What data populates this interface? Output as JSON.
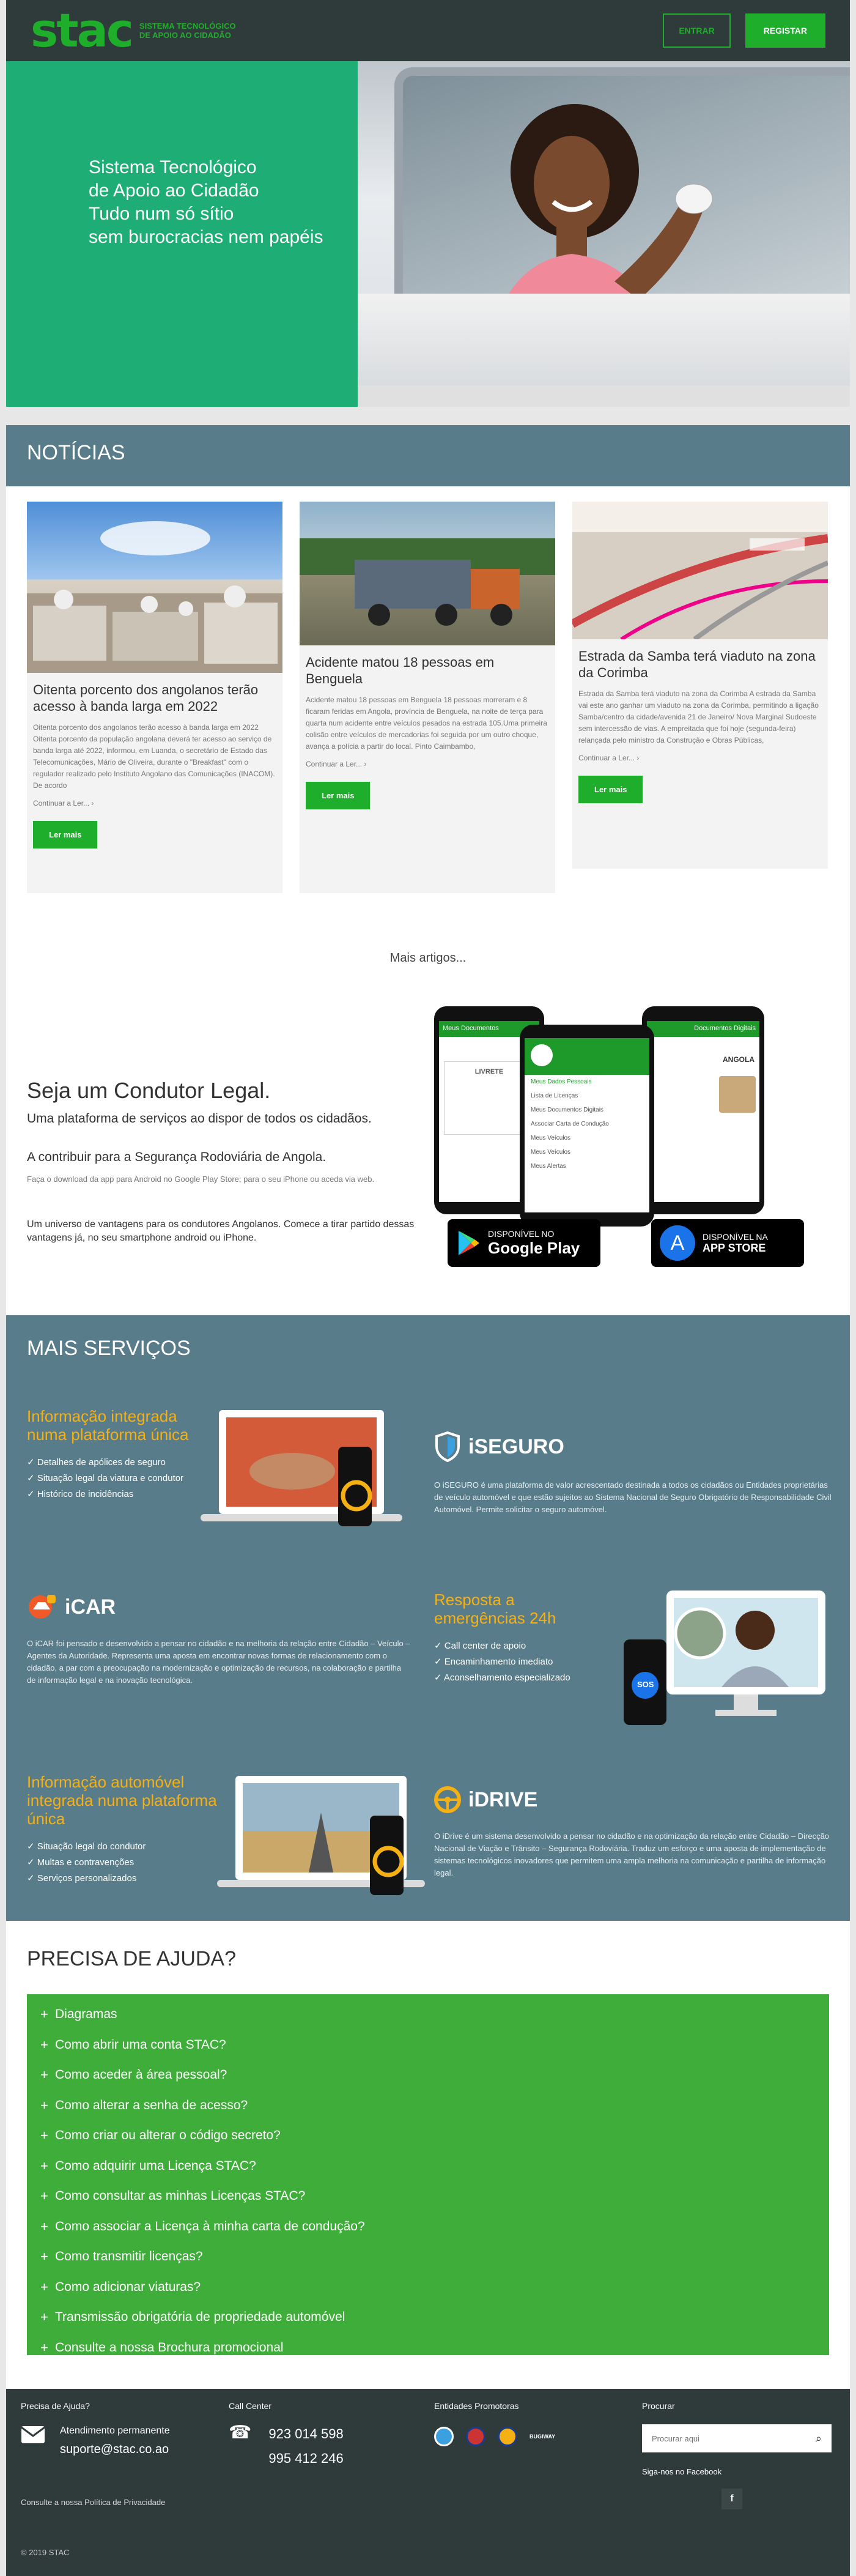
{
  "header": {
    "logo_mark": "stac",
    "logo_sub": "Sistema Tecnológico de Apoio ao Cidadão",
    "login_label": "ENTRAR",
    "register_label": "REGISTAR"
  },
  "hero": {
    "line1": "Sistema Tecnológico",
    "line2": "de Apoio ao Cidadão",
    "line3": "Tudo num só sítio",
    "line4": "sem burocracias nem papéis"
  },
  "news": {
    "section_title": "NOTÍCIAS",
    "cards": [
      {
        "title": "Oitenta porcento dos angolanos terão acesso à banda larga em 2022",
        "body": "Oitenta porcento dos angolanos terão acesso à banda larga em 2022   Oitenta porcento da população angolana deverá ter acesso ao serviço de banda larga até 2022, informou, em Luanda, o secretário de Estado das Telecomunicações, Mário de Oliveira, durante o \"Breakfast\" com o regulador realizado pelo Instituto Angolano das Comunicações (INACOM). De acordo",
        "more": "Continuar a Ler...",
        "cta": "Ler mais"
      },
      {
        "title": "Acidente matou 18 pessoas em Benguela",
        "body": "Acidente matou 18 pessoas em Benguela   18 pessoas morreram e 8 ficaram feridas em Angola, província de Benguela, na noite de terça para quarta num acidente entre veículos pesados na estrada 105.Uma primeira colisão entre veículos de mercadorias foi seguida por um outro choque, avança a polícia a partir do local. Pinto Caimbambo,",
        "more": "Continuar a Ler...",
        "cta": "Ler mais"
      },
      {
        "title": "Estrada da Samba terá viaduto na zona da Corimba",
        "body": "Estrada da Samba terá viaduto na zona da Corimba   A estrada da Samba vai este ano ganhar um viaduto na zona da Corimba, permitindo a ligação Samba/centro da cidade/avenida 21 de Janeiro/ Nova Marginal Sudoeste sem intercessão de vias. A empreitada que foi hoje (segunda-feira) relançada pelo ministro da Construção e Obras Públicas,",
        "more": "Continuar a Ler...",
        "cta": "Ler mais"
      }
    ],
    "more_articles": "Mais artigos..."
  },
  "condutor": {
    "title": "Seja um Condutor Legal.",
    "subtitle": "Uma plataforma de serviços ao dispor de todos os cidadãos.",
    "subtitle2": "A contribuir para a Segurança Rodoviária de Angola.",
    "download_text": "Faça o download da app para Android no Google Play Store; para o seu iPhone ou aceda via web.",
    "benefits_text": "Um universo de vantagens para os condutores Angolanos. Comece a tirar partido dessas vantagens já, no seu smartphone android ou iPhone.",
    "google_play_top": "DISPONÍVEL NO",
    "google_play_bottom": "Google Play",
    "app_store_top": "DISPONÍVEL NA",
    "app_store_bottom": "APP STORE",
    "phone_left_header": "Meus Documentos",
    "phone_right_header": "Documentos Digitais",
    "phone_menu": [
      "Meus Dados Pessoais",
      "Lista de Licenças",
      "Meus Documentos Digitais",
      "Associar Carta de Condução",
      "Meus Veículos",
      "Meus Veículos",
      "Meus Alertas"
    ],
    "phone_label_livrete": "LIVRETE",
    "phone_label_angola": "ANGOLA"
  },
  "servicos": {
    "section_title": "MAIS SERVIÇOS",
    "iseguro": {
      "promo_title": "Informação integrada numa plataforma única",
      "promo_items": [
        "Detalhes de apólices de seguro",
        "Situação legal da viatura e condutor",
        "Histórico de incidências"
      ],
      "brand": "iSEGURO",
      "desc": "O iSEGURO é uma plataforma de valor acrescentado destinada a todos os cidadãos ou Entidades proprietárias de veículo automóvel e que estão sujeitos ao Sistema Nacional de Seguro Obrigatório de Responsabilidade Civil Automóvel. Permite solicitar o seguro automóvel."
    },
    "icar": {
      "brand": "iCAR",
      "desc": "O iCAR foi pensado e desenvolvido a pensar no cidadão e na melhoria da relação entre Cidadão – Veículo – Agentes da Autoridade. Representa uma aposta em encontrar novas formas de relacionamento com o cidadão, a par com a preocupação na modernização e optimização de recursos, na colaboração e partilha de informação legal e na inovação tecnológica.",
      "promo_title": "Resposta a emergências 24h",
      "promo_items": [
        "Call center de apoio",
        "Encaminhamento imediato",
        "Aconselhamento especializado"
      ],
      "sos": "SOS"
    },
    "idrive": {
      "promo_title": "Informação automóvel integrada numa plataforma única",
      "promo_items": [
        "Situação legal do condutor",
        "Multas e contravenções",
        "Serviços personalizados"
      ],
      "brand": "iDRIVE",
      "desc": "O iDrive é um sistema desenvolvido a pensar no cidadão e na optimização da relação entre Cidadão – Direcção Nacional de Viação e Trânsito – Segurança Rodoviária. Traduz um esforço e uma aposta de implementação de sistemas tecnológicos inovadores que permitem uma ampla melhoria na comunicação e partilha de informação legal."
    }
  },
  "ajuda": {
    "section_title": "PRECISA DE AJUDA?",
    "items": [
      "Diagramas",
      "Como abrir uma conta STAC?",
      "Como aceder à área pessoal?",
      "Como alterar a senha de acesso?",
      "Como criar ou alterar o código secreto?",
      "Como adquirir uma Licença STAC?",
      "Como consultar as minhas Licenças STAC?",
      "Como associar a Licença à minha carta de condução?",
      "Como transmitir licenças?",
      "Como adicionar viaturas?",
      "Transmissão obrigatória de propriedade automóvel",
      "Consulte a nossa Brochura promocional"
    ]
  },
  "footer": {
    "help_title": "Precisa de Ajuda?",
    "help_label": "Atendimento permanente",
    "help_email": "suporte@stac.co.ao",
    "callcenter_title": "Call Center",
    "phone1": "923 014 598",
    "phone2": "995 412 246",
    "entidades_title": "Entidades Promotoras",
    "entidade_bugiway": "BUGIWAY",
    "procurar_title": "Procurar",
    "search_placeholder": "Procurar aqui",
    "facebook_text": "Siga-nos no Facebook",
    "privacy": "Consulte a nossa Política de Privacidade",
    "copyright": "© 2019 STAC"
  },
  "colors": {
    "brand_green": "#1fad2c",
    "hero_teal": "#1fad76",
    "section_blue": "#587c8a",
    "footer_dark": "#2f3a3a",
    "accent_orange": "#f5b014",
    "faq_green": "#3fad3a"
  }
}
